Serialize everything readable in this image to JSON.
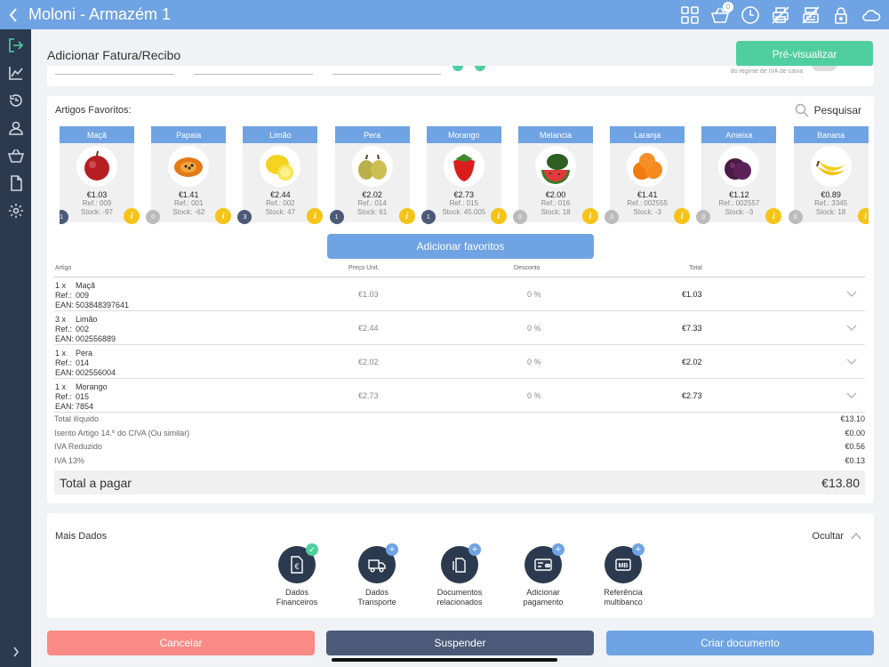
{
  "app": {
    "title": "Moloni - Armazém 1",
    "basket_count": "0"
  },
  "page": {
    "title": "Adicionar Fatura/Recibo",
    "preview_label": "Pré-visualizar",
    "iva_hint": "do regime de IVA de caixa"
  },
  "favorites": {
    "title": "Artigos Favoritos:",
    "search_label": "Pesquisar",
    "add_label": "Adicionar favoritos",
    "items": [
      {
        "name": "Maçã",
        "price": "€1.03",
        "ref": "Ref.: 009",
        "stock": "Stock: -97",
        "qty": "1",
        "fruit": "apple"
      },
      {
        "name": "Papaia",
        "price": "€1.41",
        "ref": "Ref.: 001",
        "stock": "Stock: -62",
        "qty": "0",
        "fruit": "papaya"
      },
      {
        "name": "Limão",
        "price": "€2.44",
        "ref": "Ref.: 002",
        "stock": "Stock: 47",
        "qty": "3",
        "fruit": "lemon"
      },
      {
        "name": "Pera",
        "price": "€2.02",
        "ref": "Ref.: 014",
        "stock": "Stock: 61",
        "qty": "1",
        "fruit": "pear"
      },
      {
        "name": "Morango",
        "price": "€2.73",
        "ref": "Ref.: 015",
        "stock": "Stock: 45.005",
        "qty": "1",
        "fruit": "strawberry"
      },
      {
        "name": "Melancia",
        "price": "€2.00",
        "ref": "Ref.: 016",
        "stock": "Stock: 18",
        "qty": "0",
        "fruit": "watermelon"
      },
      {
        "name": "Laranja",
        "price": "€1.41",
        "ref": "Ref.: 002555",
        "stock": "Stock: -3",
        "qty": "0",
        "fruit": "orange"
      },
      {
        "name": "Ameixa",
        "price": "€1.12",
        "ref": "Ref.: 002557",
        "stock": "Stock: -3",
        "qty": "0",
        "fruit": "plum"
      },
      {
        "name": "Banana",
        "price": "€0.89",
        "ref": "Ref.: 3345",
        "stock": "Stock: 18",
        "qty": "0",
        "fruit": "banana"
      }
    ]
  },
  "table": {
    "headers": {
      "article": "Artigo",
      "unit_price": "Preço Unit.",
      "discount": "Desconto",
      "total": "Total"
    },
    "ref_label": "Ref.:",
    "ean_label": "EAN:",
    "rows": [
      {
        "qty": "1  x",
        "name": "Maçã",
        "ref": "009",
        "ean": "5038483976 41",
        "ean_full": "503848397641",
        "unit_price": "€1.03",
        "discount": "0 %",
        "total": "€1.03"
      },
      {
        "qty": "3  x",
        "name": "Limão",
        "ref": "002",
        "ean_full": "002556889",
        "unit_price": "€2.44",
        "discount": "0 %",
        "total": "€7.33"
      },
      {
        "qty": "1  x",
        "name": "Pera",
        "ref": "014",
        "ean_full": "002556004",
        "unit_price": "€2.02",
        "discount": "0 %",
        "total": "€2.02"
      },
      {
        "qty": "1  x",
        "name": "Morango",
        "ref": "015",
        "ean_full": "7854",
        "unit_price": "€2.73",
        "discount": "0 %",
        "total": "€2.73"
      }
    ]
  },
  "totals": [
    {
      "label": "Total ilíquido",
      "value": "€13.10"
    },
    {
      "label": "Isento Artigo 14.º do CIVA (Ou similar)",
      "value": "€0.00"
    },
    {
      "label": "IVA Reduzido",
      "value": "€0.56"
    },
    {
      "label": "IVA 13%",
      "value": "€0.13"
    }
  ],
  "grand_total": {
    "label": "Total a pagar",
    "value": "€13.80"
  },
  "more": {
    "title": "Mais Dados",
    "hide_label": "Ocultar",
    "items": [
      {
        "line1": "Dados",
        "line2": "Financeiros"
      },
      {
        "line1": "Dados",
        "line2": "Transporte"
      },
      {
        "line1": "Documentos",
        "line2": "relacionados"
      },
      {
        "line1": "Adicionar",
        "line2": "pagamento"
      },
      {
        "line1": "Referência",
        "line2": "multibanco"
      }
    ]
  },
  "actions": {
    "cancel": "Cancelar",
    "suspend": "Suspender",
    "create": "Criar documento"
  },
  "colors": {
    "primary": "#6fa3e3",
    "success": "#4fcfa0",
    "danger": "#f98a85",
    "dark": "#4a5a78",
    "sidebar": "#2c3a4f",
    "info": "#f6c318"
  }
}
